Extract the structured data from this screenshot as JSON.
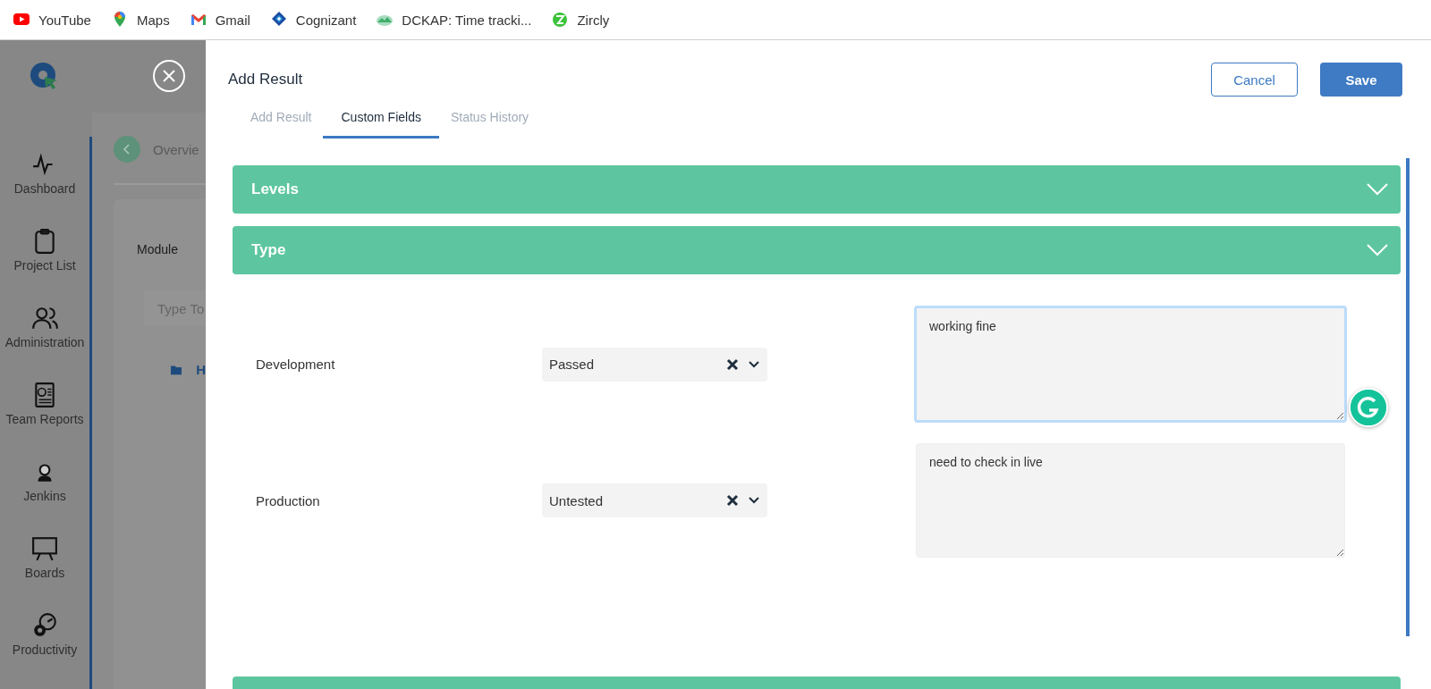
{
  "bookmarks": [
    {
      "label": "YouTube"
    },
    {
      "label": "Maps"
    },
    {
      "label": "Gmail"
    },
    {
      "label": "Cognizant"
    },
    {
      "label": "DCKAP: Time tracki..."
    },
    {
      "label": "Zircly"
    }
  ],
  "sidebar": {
    "items": [
      {
        "label": "Dashboard"
      },
      {
        "label": "Project List"
      },
      {
        "label": "Administration"
      },
      {
        "label": "Team Reports"
      },
      {
        "label": "Jenkins"
      },
      {
        "label": "Boards"
      },
      {
        "label": "Productivity"
      }
    ]
  },
  "background": {
    "breadcrumb": "Overvie",
    "panel_title": "Module",
    "search": {
      "placeholder": "Type To"
    },
    "tree_item": "H"
  },
  "dialog": {
    "title": "Add Result",
    "buttons": [
      {
        "label": "Cancel",
        "kind": "secondary"
      },
      {
        "label": "Save",
        "kind": "primary"
      }
    ],
    "tabs": [
      {
        "label": "Add Result",
        "selected": false
      },
      {
        "label": "Custom Fields",
        "selected": true
      },
      {
        "label": "Status History",
        "selected": false
      }
    ],
    "sections": [
      {
        "title": "Levels",
        "expanded": false
      },
      {
        "title": "Type",
        "expanded": false
      }
    ],
    "rows": [
      {
        "label": "Development",
        "status": "Passed",
        "comment": "working fine",
        "focused": true
      },
      {
        "label": "Production",
        "status": "Untested",
        "comment": "need to check in live",
        "focused": false
      }
    ]
  }
}
